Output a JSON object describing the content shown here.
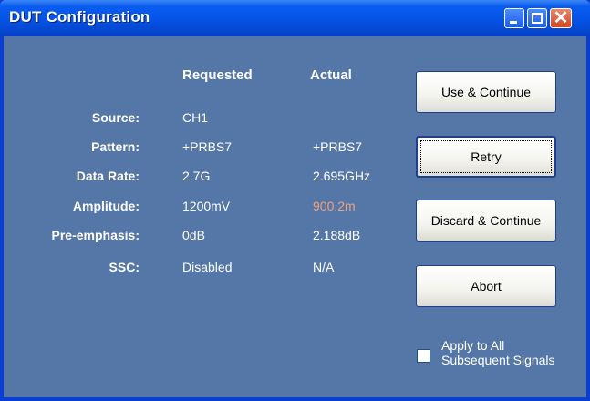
{
  "window": {
    "title": "DUT Configuration",
    "controls": [
      "minimize-icon",
      "maximize-icon",
      "close-icon"
    ],
    "close_glyph": "✕"
  },
  "table": {
    "headers": {
      "requested": "Requested",
      "actual": "Actual"
    },
    "rows": [
      {
        "label": "Source:",
        "requested": "CH1",
        "actual": ""
      },
      {
        "label": "Pattern:",
        "requested": "+PRBS7",
        "actual": "+PRBS7"
      },
      {
        "label": "Data Rate:",
        "requested": "2.7G",
        "actual": "2.695GHz"
      },
      {
        "label": "Amplitude:",
        "requested": "1200mV",
        "actual": "900.2m",
        "actual_color": "#f0a07a"
      },
      {
        "label": "Pre-emphasis:",
        "requested": "0dB",
        "actual": "2.188dB"
      },
      {
        "label": "SSC:",
        "requested": "Disabled",
        "actual": "N/A"
      }
    ]
  },
  "buttons": {
    "use_continue": "Use & Continue",
    "retry": "Retry",
    "discard_continue": "Discard & Continue",
    "abort": "Abort"
  },
  "apply_all": {
    "line1": "Apply to All",
    "line2": "Subsequent Signals",
    "checked": false
  },
  "colors": {
    "background": "#5577a7",
    "titlebar": "#0553e6",
    "warning_value": "#f0a07a"
  }
}
